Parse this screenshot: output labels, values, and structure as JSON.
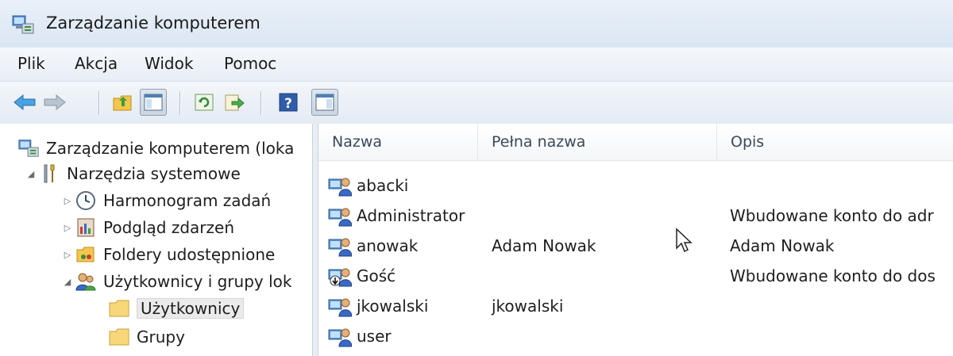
{
  "window": {
    "title": "Zarządzanie komputerem",
    "title_icon": "computer-management-icon"
  },
  "menu": {
    "items": [
      "Plik",
      "Akcja",
      "Widok",
      "Pomoc"
    ]
  },
  "toolbar": {
    "buttons": [
      "back-arrow-icon",
      "forward-arrow-icon",
      "up-folder-icon",
      "show-hide-console-tree-icon",
      "refresh-icon",
      "export-list-icon",
      "help-icon",
      "show-hide-action-pane-icon"
    ]
  },
  "tree": {
    "items": [
      {
        "label": "Zarządzanie komputerem (loka",
        "icon": "computer-management-icon",
        "expander": ""
      },
      {
        "label": "Narzędzia systemowe",
        "icon": "tools-icon",
        "expander": "expanded"
      },
      {
        "label": "Harmonogram zadań",
        "icon": "clock-icon",
        "expander": "collapsed"
      },
      {
        "label": "Podgląd zdarzeń",
        "icon": "event-viewer-icon",
        "expander": "collapsed"
      },
      {
        "label": "Foldery udostępnione",
        "icon": "shared-folder-icon",
        "expander": "collapsed"
      },
      {
        "label": "Użytkownicy i grupy lok",
        "icon": "users-groups-icon",
        "expander": "expanded"
      },
      {
        "label": "Użytkownicy",
        "icon": "folder-icon",
        "expander": "",
        "selected": true
      },
      {
        "label": "Grupy",
        "icon": "folder-icon",
        "expander": ""
      }
    ]
  },
  "list": {
    "columns": [
      "Nazwa",
      "Pełna nazwa",
      "Opis"
    ],
    "rows": [
      {
        "name": "abacki",
        "full_name": "",
        "description": "",
        "icon": "user-icon"
      },
      {
        "name": "Administrator",
        "full_name": "",
        "description": "Wbudowane konto do adr",
        "icon": "user-icon"
      },
      {
        "name": "anowak",
        "full_name": "Adam Nowak",
        "description": "Adam Nowak",
        "icon": "user-icon"
      },
      {
        "name": "Gość",
        "full_name": "",
        "description": "Wbudowane konto do dos",
        "icon": "disabled-user-icon"
      },
      {
        "name": "jkowalski",
        "full_name": "jkowalski",
        "description": "",
        "icon": "user-icon"
      },
      {
        "name": "user",
        "full_name": "",
        "description": "",
        "icon": "user-icon"
      }
    ]
  }
}
